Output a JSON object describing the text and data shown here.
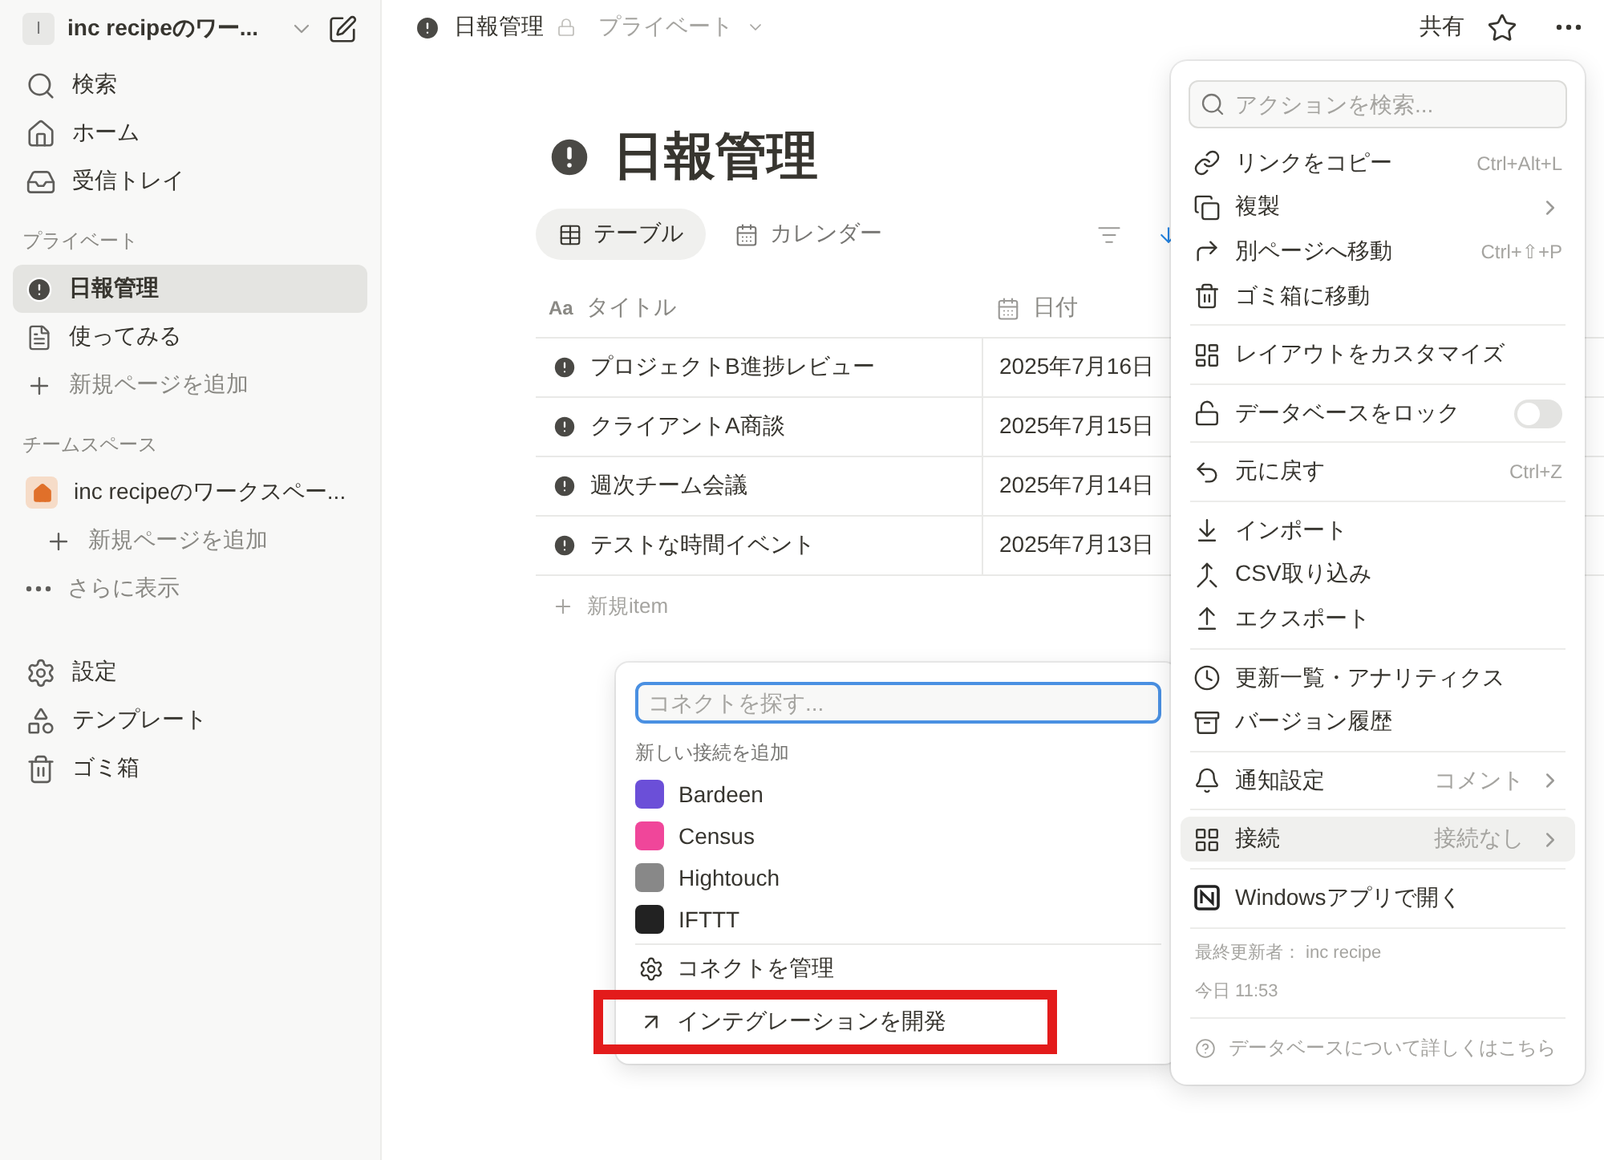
{
  "sidebar": {
    "workspace": {
      "initial": "I",
      "name": "inc recipeのワー..."
    },
    "top_items": [
      {
        "label": "検索",
        "selected": false
      },
      {
        "label": "ホーム",
        "selected": false
      },
      {
        "label": "受信トレイ",
        "selected": false
      }
    ],
    "sections": [
      {
        "heading": "プライベート",
        "items": [
          {
            "kind": "page",
            "label": "日報管理",
            "selected": true
          },
          {
            "kind": "doc",
            "label": "使ってみる",
            "selected": false
          },
          {
            "kind": "add",
            "label": "新規ページを追加",
            "selected": false
          }
        ]
      },
      {
        "heading": "チームスペース",
        "items": [
          {
            "kind": "team",
            "label": "inc recipeのワークスペー...",
            "selected": false
          },
          {
            "kind": "add-indent",
            "label": "新規ページを追加",
            "selected": false
          },
          {
            "kind": "more",
            "label": "さらに表示",
            "selected": false
          }
        ]
      }
    ],
    "bottom_items": [
      {
        "label": "設定",
        "selected": false
      },
      {
        "label": "テンプレート",
        "selected": false
      },
      {
        "label": "ゴミ箱",
        "selected": false
      }
    ]
  },
  "topbar": {
    "breadcrumb": "日報管理",
    "visibility": "プライベート",
    "share": "共有"
  },
  "page": {
    "title": "日報管理",
    "views": [
      {
        "label": "テーブル",
        "selected": true
      },
      {
        "label": "カレンダー",
        "selected": false
      }
    ],
    "table": {
      "columns": [
        {
          "label": "タイトル",
          "type_mark": "Aa"
        },
        {
          "label": "日付"
        }
      ],
      "rows": [
        {
          "title": "プロジェクトB進捗レビュー",
          "date": "2025年7月16日"
        },
        {
          "title": "クライアントA商談",
          "date": "2025年7月15日"
        },
        {
          "title": "週次チーム会議",
          "date": "2025年7月14日"
        },
        {
          "title": "テストな時間イベント",
          "date": "2025年7月13日"
        }
      ],
      "new_row": "新規item"
    }
  },
  "action_menu": {
    "search": {
      "placeholder": "アクションを検索..."
    },
    "groups": [
      [
        {
          "kind": "item",
          "label": "リンクをコピー",
          "shortcut": "Ctrl+Alt+L",
          "submenu": false,
          "selected": false
        },
        {
          "kind": "item",
          "label": "複製",
          "submenu": true,
          "selected": false
        },
        {
          "kind": "item",
          "label": "別ページへ移動",
          "shortcut": "Ctrl+⇧+P",
          "submenu": false,
          "selected": false
        },
        {
          "kind": "item",
          "label": "ゴミ箱に移動",
          "submenu": false,
          "selected": false
        }
      ],
      [
        {
          "kind": "item",
          "label": "レイアウトをカスタマイズ",
          "submenu": false,
          "selected": false
        }
      ],
      [
        {
          "kind": "toggle",
          "label": "データベースをロック",
          "on": false,
          "selected": false
        }
      ],
      [
        {
          "kind": "item",
          "label": "元に戻す",
          "shortcut": "Ctrl+Z",
          "submenu": false,
          "selected": false
        }
      ],
      [
        {
          "kind": "item",
          "label": "インポート",
          "submenu": false,
          "selected": false
        },
        {
          "kind": "item",
          "label": "CSV取り込み",
          "submenu": false,
          "selected": false
        },
        {
          "kind": "item",
          "label": "エクスポート",
          "submenu": false,
          "selected": false
        }
      ],
      [
        {
          "kind": "item",
          "label": "更新一覧・アナリティクス",
          "submenu": false,
          "selected": false
        },
        {
          "kind": "item",
          "label": "バージョン履歴",
          "submenu": false,
          "selected": false
        }
      ],
      [
        {
          "kind": "item",
          "label": "通知設定",
          "value": "コメント",
          "submenu": true,
          "selected": false
        }
      ],
      [
        {
          "kind": "item",
          "label": "接続",
          "value": "接続なし",
          "submenu": true,
          "selected": true
        }
      ],
      [
        {
          "kind": "item",
          "label": "Windowsアプリで開く",
          "submenu": false,
          "selected": false
        }
      ]
    ],
    "last_edited": "最終更新者： inc recipe",
    "edited_time": "今日 11:53",
    "help": "データベースについて詳しくはこちら"
  },
  "connect_popup": {
    "search": {
      "placeholder": "コネクトを探す..."
    },
    "heading": "新しい接続を追加",
    "integrations": [
      {
        "name": "Bardeen",
        "color": "#6b4fd8"
      },
      {
        "name": "Census",
        "color": "#f0469a"
      },
      {
        "name": "Hightouch",
        "color": "#888888"
      },
      {
        "name": "IFTTT",
        "color": "#222222"
      }
    ],
    "actions": [
      {
        "label": "コネクトを管理",
        "highlighted": false
      },
      {
        "label": "インテグレーションを開発",
        "highlighted": true
      }
    ]
  }
}
